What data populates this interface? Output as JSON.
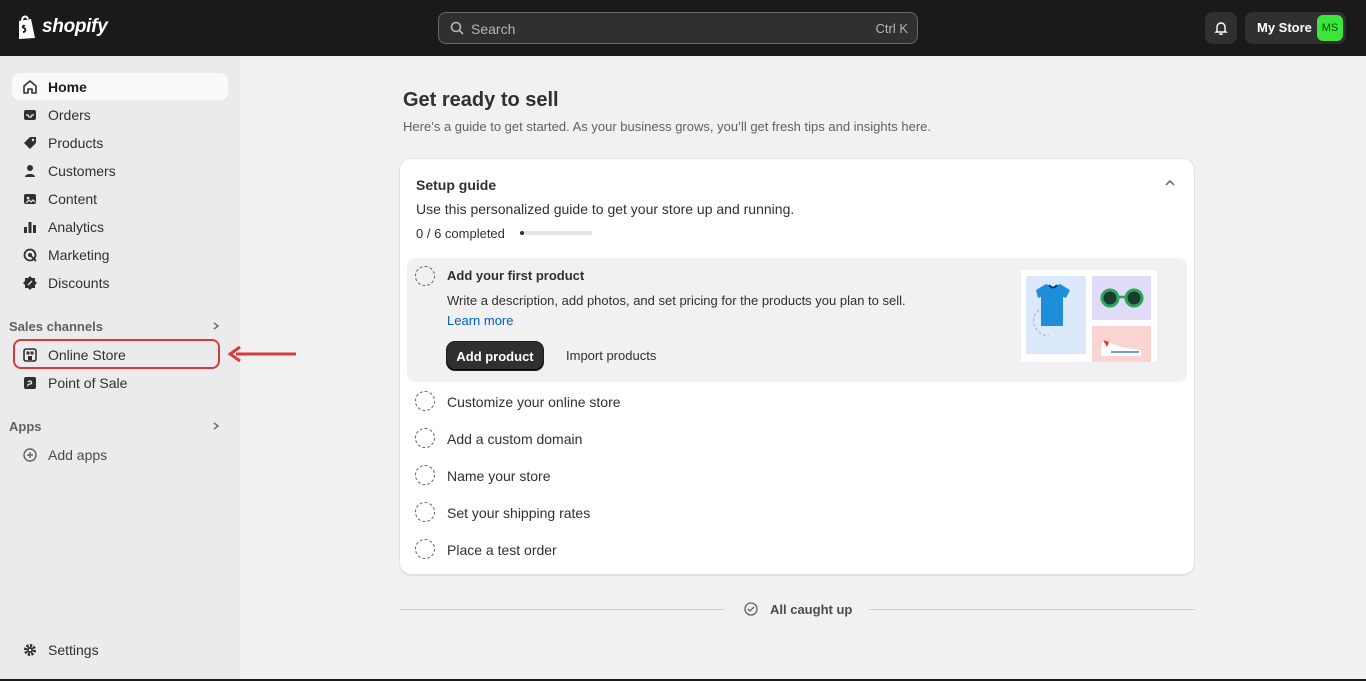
{
  "topbar": {
    "brand": "shopify",
    "search_placeholder": "Search",
    "search_shortcut": "Ctrl K",
    "store_name": "My Store",
    "store_initials": "MS",
    "avatar_color": "#3be53b"
  },
  "sidebar": {
    "items": [
      {
        "label": "Home",
        "icon": "home-icon"
      },
      {
        "label": "Orders",
        "icon": "inbox-icon"
      },
      {
        "label": "Products",
        "icon": "tag-icon"
      },
      {
        "label": "Customers",
        "icon": "person-icon"
      },
      {
        "label": "Content",
        "icon": "image-icon"
      },
      {
        "label": "Analytics",
        "icon": "bar-chart-icon"
      },
      {
        "label": "Marketing",
        "icon": "target-icon"
      },
      {
        "label": "Discounts",
        "icon": "discount-icon"
      }
    ],
    "sales_channels_title": "Sales channels",
    "sales_channels": [
      {
        "label": "Online Store",
        "icon": "store-icon"
      },
      {
        "label": "Point of Sale",
        "icon": "pos-icon"
      }
    ],
    "apps_title": "Apps",
    "add_apps_label": "Add apps",
    "settings_label": "Settings"
  },
  "main": {
    "title": "Get ready to sell",
    "subtitle": "Here’s a guide to get started. As your business grows, you’ll get fresh tips and insights here.",
    "setup_guide": {
      "title": "Setup guide",
      "description": "Use this personalized guide to get your store up and running.",
      "progress_text": "0 / 6 completed",
      "progress_fraction": 0.0,
      "active_task": {
        "title": "Add your first product",
        "description": "Write a description, add photos, and set pricing for the products you plan to sell.",
        "link": "Learn more",
        "primary_button": "Add product",
        "secondary_button": "Import products"
      },
      "tasks": [
        "Customize your online store",
        "Add a custom domain",
        "Name your store",
        "Set your shipping rates",
        "Place a test order"
      ]
    },
    "footer_status": "All caught up"
  }
}
